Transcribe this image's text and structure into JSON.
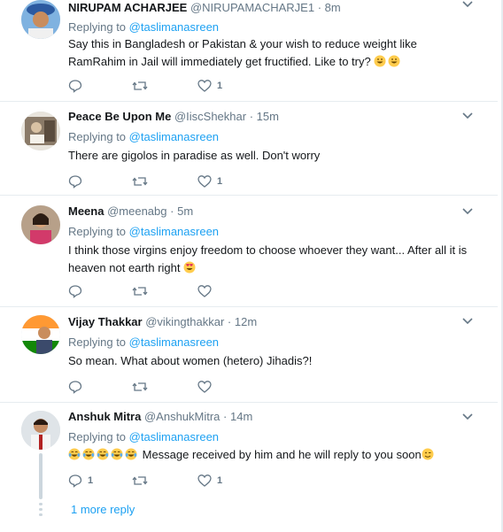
{
  "tweets": [
    {
      "name": "NIRUPAM ACHARJEE",
      "handle": "@NIRUPAMACHARJE1",
      "dot": "·",
      "time": "8m",
      "replying_prefix": "Replying to",
      "replying_to": "@taslimanasreen",
      "text": "Say this in Bangladesh or Pakistan & your wish to reduce weight like RamRahim in Jail will immediately get fructified. Like to try?",
      "emoji_count": 2,
      "reply_count": "",
      "retweet_count": "",
      "like_count": "1"
    },
    {
      "name": "Peace Be Upon Me",
      "handle": "@IiscShekhar",
      "dot": "·",
      "time": "15m",
      "replying_prefix": "Replying to",
      "replying_to": "@taslimanasreen",
      "text": "There are gigolos in paradise as well. Don't worry",
      "reply_count": "",
      "retweet_count": "",
      "like_count": "1"
    },
    {
      "name": "Meena",
      "handle": "@meenabg",
      "dot": "·",
      "time": "5m",
      "replying_prefix": "Replying to",
      "replying_to": "@taslimanasreen",
      "text": "I think those virgins enjoy freedom to choose whoever they want... After all it is heaven not earth right",
      "reply_count": "",
      "retweet_count": "",
      "like_count": ""
    },
    {
      "name": "Vijay Thakkar",
      "handle": "@vikingthakkar",
      "dot": "·",
      "time": "12m",
      "replying_prefix": "Replying to",
      "replying_to": "@taslimanasreen",
      "text": "So mean. What about women (hetero) Jihadis?!",
      "reply_count": "",
      "retweet_count": "",
      "like_count": ""
    },
    {
      "name": "Anshuk Mitra",
      "handle": "@AnshukMitra",
      "dot": "·",
      "time": "14m",
      "replying_prefix": "Replying to",
      "replying_to": "@taslimanasreen",
      "text": "Message received by him and he will reply to you soon",
      "reply_count": "1",
      "retweet_count": "",
      "like_count": "1"
    }
  ],
  "more_replies": "1 more reply",
  "icons": {
    "reply": "reply-icon",
    "retweet": "retweet-icon",
    "like": "heart-icon",
    "caret": "chevron-down-icon"
  },
  "colors": {
    "link": "#1da1f2",
    "secondary": "#657786",
    "divider": "#e6ecf0"
  }
}
